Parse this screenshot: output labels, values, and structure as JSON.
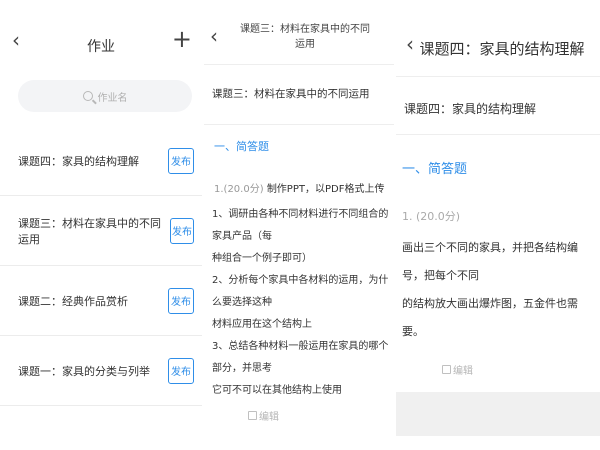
{
  "panel1": {
    "back_icon": "‹",
    "title": "作业",
    "add_icon": "+",
    "search_placeholder": "作业名",
    "items": [
      {
        "label": "课题四：家具的结构理解",
        "button": "发布"
      },
      {
        "label": "课题三：材料在家具中的不同运用",
        "button": "发布"
      },
      {
        "label": "课题二：经典作品赏析",
        "button": "发布"
      },
      {
        "label": "课题一：家具的分类与列举",
        "button": "发布"
      }
    ]
  },
  "panel2": {
    "back_icon": "‹",
    "title_line1": "课题三：材料在家具中的不同",
    "title_line2": "运用",
    "course_name": "课题三：材料在家具中的不同运用",
    "section": "一、简答题",
    "question_num": "1.",
    "question_score": "(20.0分)",
    "question_title": "制作PPT，以PDF格式上传",
    "body_lines": [
      "1、调研由各种不同材料进行不同组合的家具产品（每",
      "种组合一个例子即可）",
      "2、分析每个家具中各材料的运用，为什么要选择这种",
      "材料应用在这个结构上",
      "3、总结各种材料一般运用在家具的哪个部分，并思考",
      "它可不可以在其他结构上使用"
    ],
    "edit_label": "编辑"
  },
  "panel3": {
    "back_icon": "‹",
    "title": "课题四：家具的结构理解",
    "course_name": "课题四：家具的结构理解",
    "section": "一、简答题",
    "question_score": "1. (20.0分)",
    "body_lines": [
      "画出三个不同的家具，并把各结构编号，把每个不同",
      "的结构放大画出爆炸图，五金件也需要。"
    ],
    "edit_label": "编辑"
  },
  "colors": {
    "accent": "#2f8ee8",
    "divider": "#ececec",
    "search_bg": "#f3f4f6",
    "footer_bg": "#f0f0f0"
  }
}
